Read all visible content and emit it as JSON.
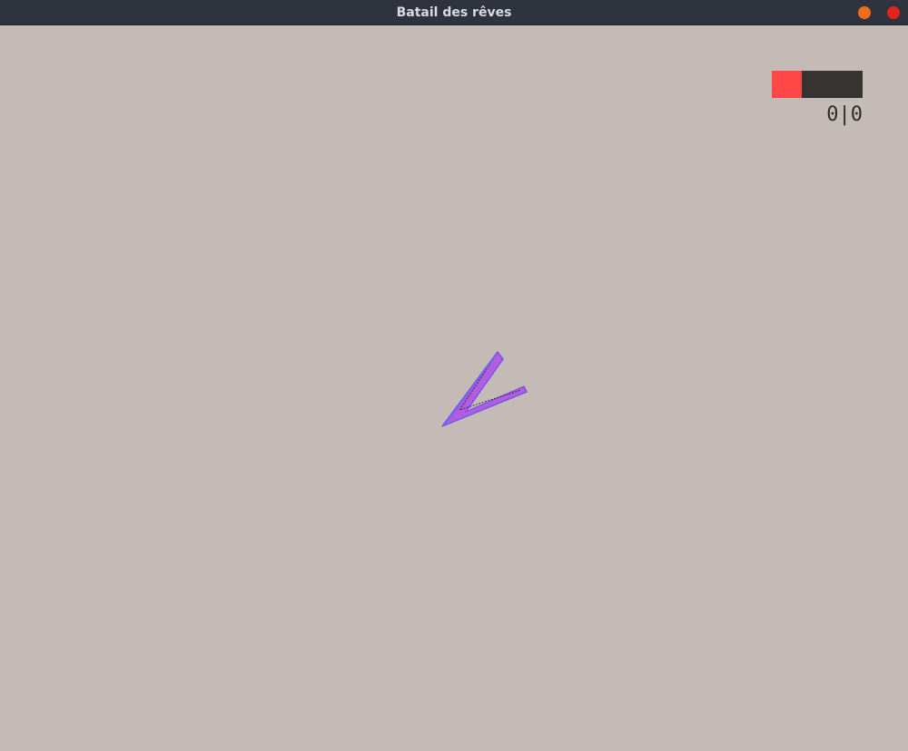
{
  "window": {
    "title": "Batail des rêves",
    "minimize_color": "#f46d1e",
    "close_color": "#e4231c"
  },
  "game": {
    "background_color": "#c5bbb6",
    "health": {
      "fraction": 0.33,
      "fill_color": "#ff4747",
      "track_color": "#363331"
    },
    "score_text": "0|0",
    "player_ship": {
      "icon": "chevron-arrow-ship",
      "color": "#b25ce0",
      "outline_color": "#7a55e6"
    }
  }
}
